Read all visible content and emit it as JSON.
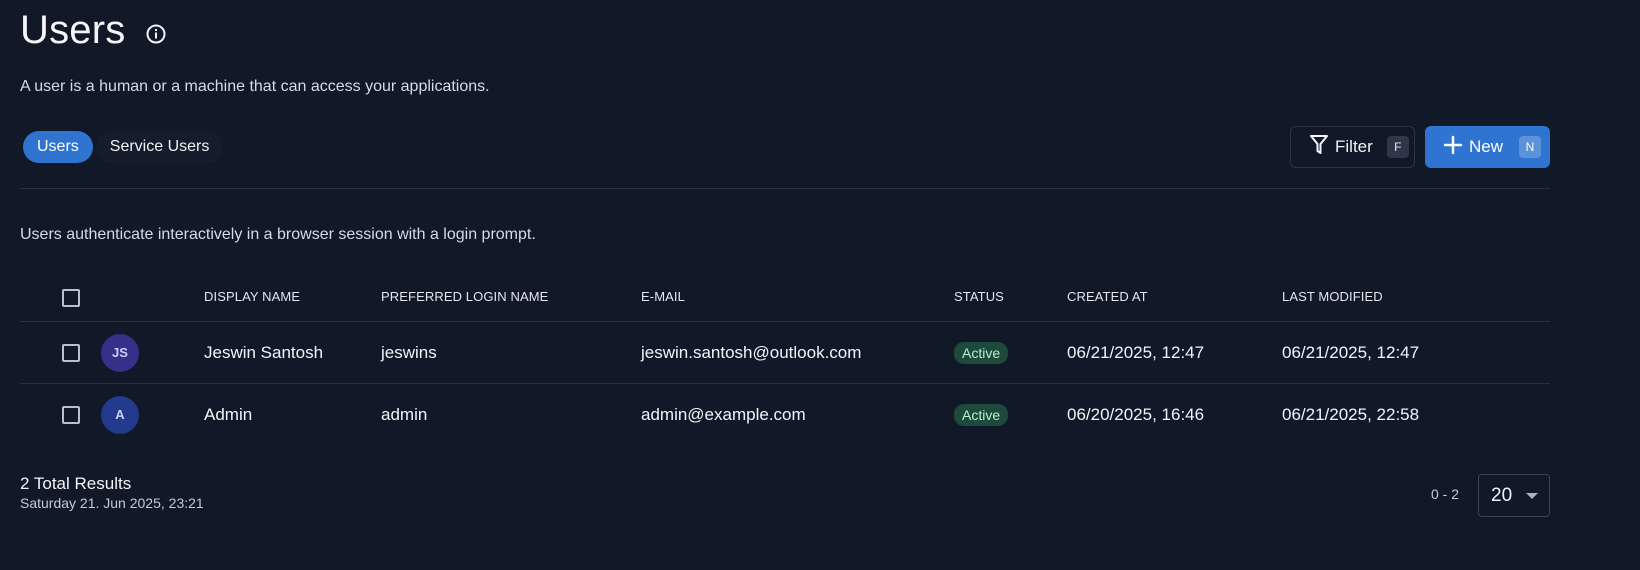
{
  "header": {
    "title": "Users",
    "subtitle": "A user is a human or a machine that can access your applications."
  },
  "tabs": [
    {
      "label": "Users",
      "active": true
    },
    {
      "label": "Service Users",
      "active": false
    }
  ],
  "toolbar": {
    "filter_label": "Filter",
    "filter_shortcut": "F",
    "new_label": "New",
    "new_shortcut": "N"
  },
  "description": "Users authenticate interactively in a browser session with a login prompt.",
  "table": {
    "columns": [
      "DISPLAY NAME",
      "PREFERRED LOGIN NAME",
      "E-MAIL",
      "STATUS",
      "CREATED AT",
      "LAST MODIFIED"
    ],
    "rows": [
      {
        "initials": "JS",
        "avatar_color": "#35318a",
        "display_name": "Jeswin Santosh",
        "login_name": "jeswins",
        "email": "jeswin.santosh@outlook.com",
        "status": "Active",
        "created_at": "06/21/2025, 12:47",
        "last_modified": "06/21/2025, 12:47"
      },
      {
        "initials": "A",
        "avatar_color": "#243a8c",
        "display_name": "Admin",
        "login_name": "admin",
        "email": "admin@example.com",
        "status": "Active",
        "created_at": "06/20/2025, 16:46",
        "last_modified": "06/21/2025, 22:58"
      }
    ]
  },
  "footer": {
    "total": "2 Total Results",
    "timestamp": "Saturday 21. Jun 2025, 23:21",
    "range": "0 - 2",
    "page_size": "20"
  },
  "colors": {
    "background": "#111827",
    "accent": "#2f74d0",
    "status_active_bg": "#1d4a3a",
    "status_active_text": "#b8f0cf"
  }
}
